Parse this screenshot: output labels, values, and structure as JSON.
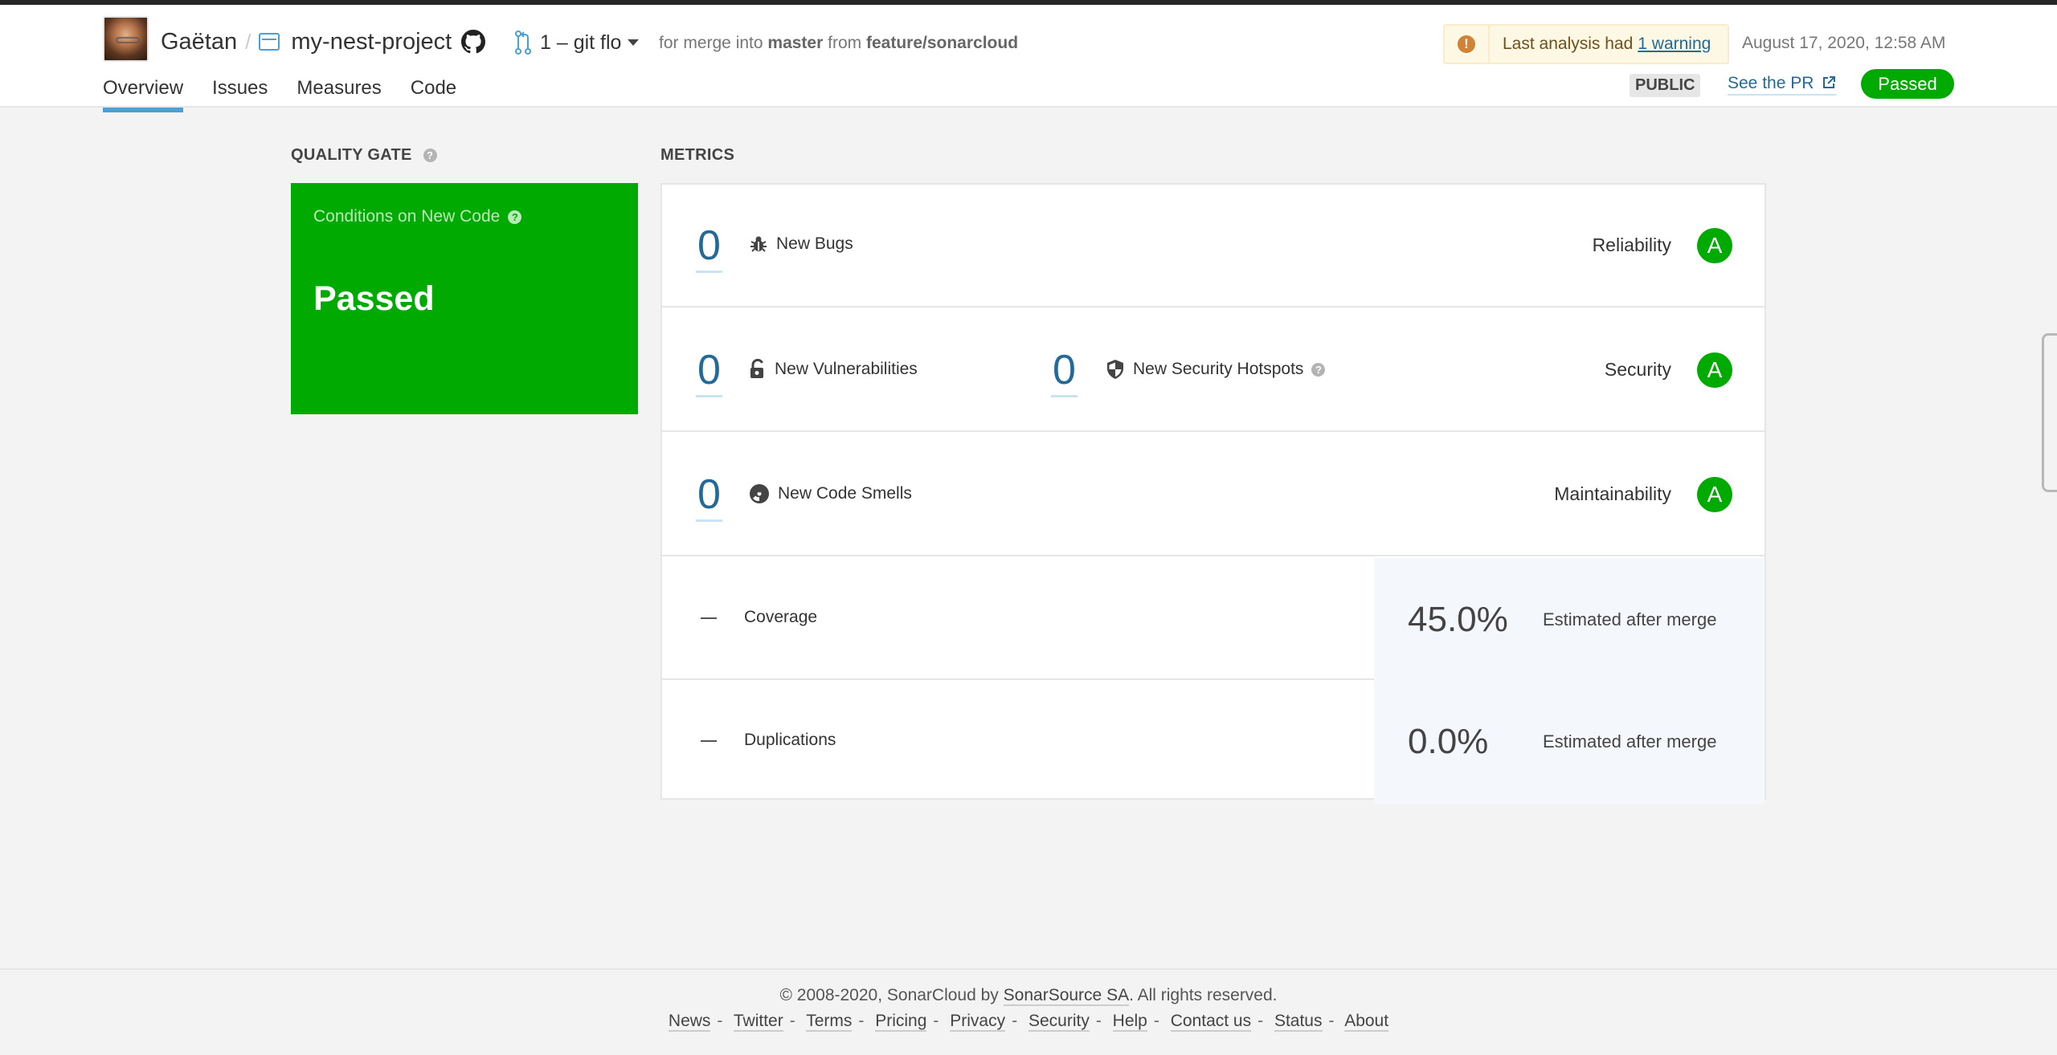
{
  "header": {
    "owner": "Gaëtan",
    "separator": "/",
    "project": "my-nest-project",
    "branch_label": "1 – git flo",
    "merge_prefix": "for merge into",
    "target_branch": "master",
    "merge_mid": "from",
    "source_branch": "feature/sonarcloud",
    "warning_text": "Last analysis had",
    "warning_link": "1 warning",
    "date": "August 17, 2020, 12:58 AM",
    "visibility": "PUBLIC",
    "see_pr": "See the PR",
    "status_badge": "Passed",
    "tabs": [
      {
        "label": "Overview",
        "active": true
      },
      {
        "label": "Issues",
        "active": false
      },
      {
        "label": "Measures",
        "active": false
      },
      {
        "label": "Code",
        "active": false
      }
    ]
  },
  "quality_gate": {
    "title": "QUALITY GATE",
    "subtitle": "Conditions on New Code",
    "status": "Passed",
    "color": "#00aa00"
  },
  "metrics": {
    "title": "METRICS",
    "bugs": {
      "value": "0",
      "label": "New Bugs",
      "rating_label": "Reliability",
      "rating": "A"
    },
    "vulnerabilities": {
      "value": "0",
      "label": "New Vulnerabilities"
    },
    "hotspots": {
      "value": "0",
      "label": "New Security Hotspots"
    },
    "security": {
      "rating_label": "Security",
      "rating": "A"
    },
    "code_smells": {
      "value": "0",
      "label": "New Code Smells",
      "rating_label": "Maintainability",
      "rating": "A"
    },
    "coverage": {
      "new_value": "—",
      "label": "Coverage",
      "estimate": "45.0%",
      "estimate_label": "Estimated after merge"
    },
    "duplications": {
      "new_value": "—",
      "label": "Duplications",
      "estimate": "0.0%",
      "estimate_label": "Estimated after merge"
    }
  },
  "footer": {
    "copyright_prefix": "© 2008-2020, SonarCloud by",
    "company": "SonarSource SA",
    "copyright_suffix": ". All rights reserved.",
    "links": [
      "News",
      "Twitter",
      "Terms",
      "Pricing",
      "Privacy",
      "Security",
      "Help",
      "Contact us",
      "Status",
      "About"
    ]
  }
}
